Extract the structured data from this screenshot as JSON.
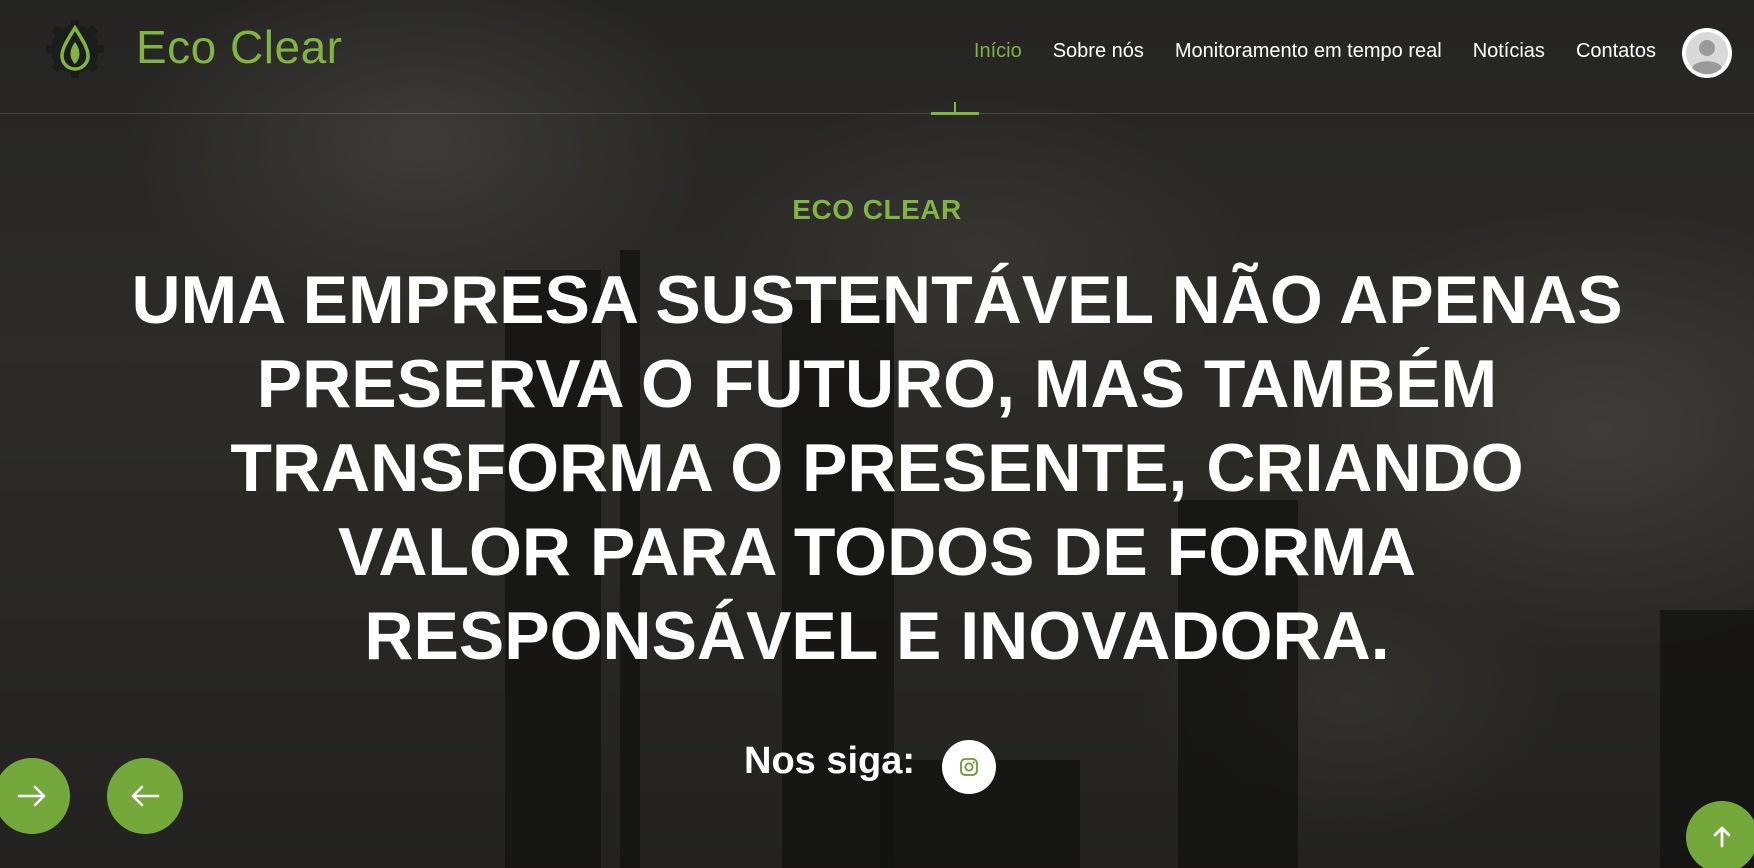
{
  "header": {
    "brand": "Eco Clear",
    "nav": [
      {
        "label": "Início",
        "active": true
      },
      {
        "label": "Sobre nós",
        "active": false
      },
      {
        "label": "Monitoramento em tempo real",
        "active": false
      },
      {
        "label": "Notícias",
        "active": false
      },
      {
        "label": "Contatos",
        "active": false
      }
    ],
    "avatar_icon": "user-avatar-icon"
  },
  "hero": {
    "eyebrow": "ECO CLEAR",
    "headline": "UMA EMPRESA SUSTENTÁVEL NÃO APENAS PRESERVA O FUTURO, MAS TAMBÉM TRANSFORMA O PRESENTE, CRIANDO VALOR PARA TODOS DE FORMA RESPONSÁVEL E INOVADORA.",
    "follow_label": "Nos siga:",
    "social_icon": "instagram-icon"
  },
  "slider": {
    "next_icon": "arrow-right-icon",
    "prev_icon": "arrow-left-icon"
  },
  "back_to_top_icon": "arrow-up-icon",
  "colors": {
    "accent": "#7fb540",
    "button": "#74a83b",
    "text": "#ffffff"
  }
}
